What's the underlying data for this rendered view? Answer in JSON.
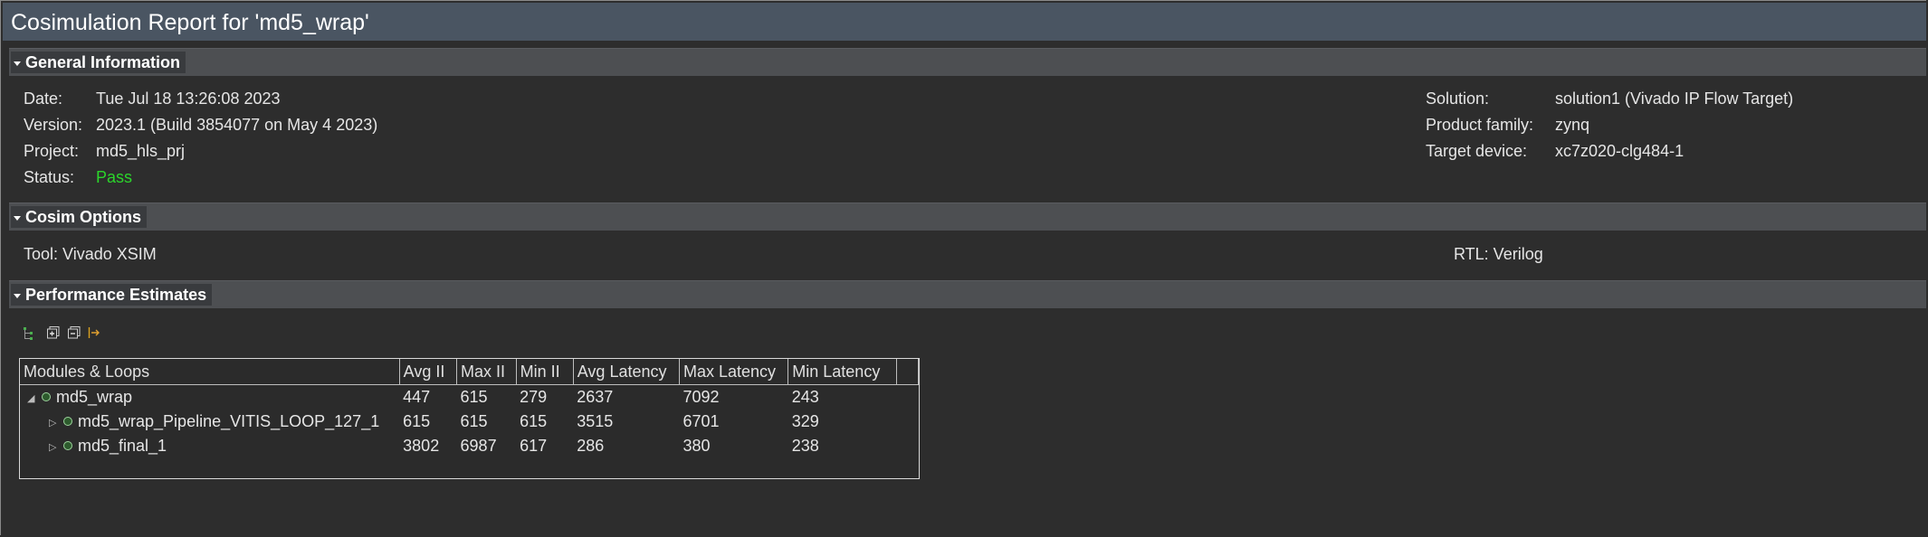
{
  "window": {
    "title": "Cosimulation Report for 'md5_wrap'"
  },
  "sections": {
    "general": "General Information",
    "cosim": "Cosim Options",
    "performance": "Performance Estimates"
  },
  "general_info": {
    "date_label": "Date:",
    "date_value": "Tue Jul 18 13:26:08 2023",
    "version_label": "Version:",
    "version_value": "2023.1 (Build 3854077 on May 4 2023)",
    "project_label": "Project:",
    "project_value": "md5_hls_prj",
    "status_label": "Status:",
    "status_value": "Pass",
    "solution_label": "Solution:",
    "solution_value": "solution1 (Vivado IP Flow Target)",
    "family_label": "Product family:",
    "family_value": "zynq",
    "device_label": "Target device:",
    "device_value": "xc7z020-clg484-1"
  },
  "cosim_options": {
    "tool": "Tool: Vivado XSIM",
    "rtl": "RTL: Verilog"
  },
  "toolbar": {
    "icons": [
      "hierarchy-icon",
      "expand-all-icon",
      "collapse-all-icon",
      "export-icon"
    ]
  },
  "table": {
    "columns": [
      "Modules & Loops",
      "Avg II",
      "Max II",
      "Min II",
      "Avg Latency",
      "Max Latency",
      "Min Latency"
    ],
    "rows": [
      {
        "name": "md5_wrap",
        "avg_ii": "447",
        "max_ii": "615",
        "min_ii": "279",
        "avg_lat": "2637",
        "max_lat": "7092",
        "min_lat": "243"
      },
      {
        "name": "md5_wrap_Pipeline_VITIS_LOOP_127_1",
        "avg_ii": "615",
        "max_ii": "615",
        "min_ii": "615",
        "avg_lat": "3515",
        "max_lat": "6701",
        "min_lat": "329"
      },
      {
        "name": "md5_final_1",
        "avg_ii": "3802",
        "max_ii": "6987",
        "min_ii": "617",
        "avg_lat": "286",
        "max_lat": "380",
        "min_lat": "238"
      }
    ]
  },
  "colors": {
    "title_bar": "#4a5562",
    "section_bar": "#4d4f52",
    "background": "#2d2d2d",
    "pass": "#2bd52b"
  }
}
